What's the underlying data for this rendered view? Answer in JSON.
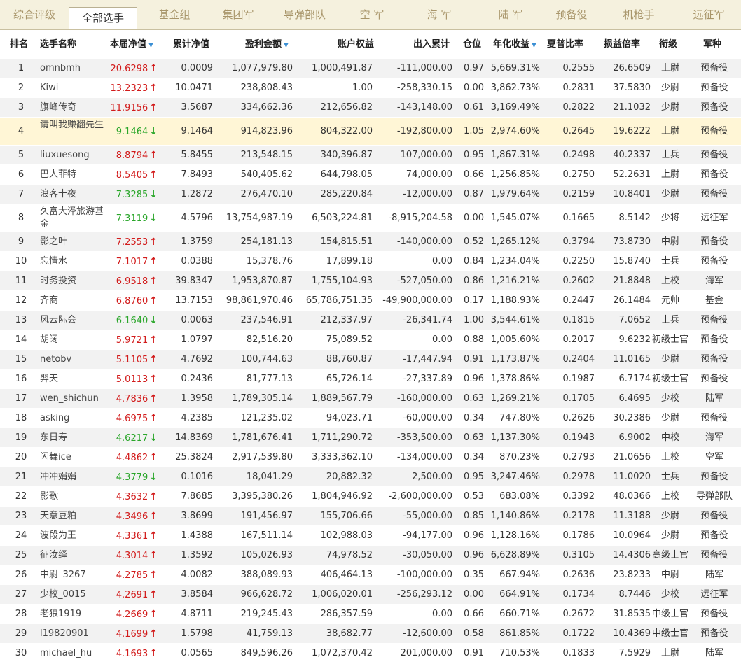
{
  "tabs": [
    {
      "label": "综合评级",
      "active": false
    },
    {
      "label": "全部选手",
      "active": true
    },
    {
      "label": "基金组",
      "active": false
    },
    {
      "label": "集团军",
      "active": false
    },
    {
      "label": "导弹部队",
      "active": false
    },
    {
      "label": "空 军",
      "active": false
    },
    {
      "label": "海 军",
      "active": false
    },
    {
      "label": "陆 军",
      "active": false
    },
    {
      "label": "预备役",
      "active": false
    },
    {
      "label": "机枪手",
      "active": false
    },
    {
      "label": "远征军",
      "active": false
    }
  ],
  "columns": [
    "排名",
    "选手名称",
    "本届净值",
    "累计净值",
    "盈利金额",
    "账户权益",
    "出入累计",
    "仓位",
    "年化收益",
    "夏普比率",
    "损益倍率",
    "衔级",
    "军种"
  ],
  "sortable_columns": [
    "本届净值",
    "盈利金额",
    "年化收益"
  ],
  "colors": {
    "up": "#d21b1b",
    "down": "#2aa62a",
    "highlight": "#fff6d6",
    "tab_bg": "#f5f1de"
  },
  "rows": [
    {
      "rank": "1",
      "name": "omnbmh",
      "nav": "20.6298",
      "dir": "up",
      "cum": "0.0009",
      "profit": "1,077,979.80",
      "equity": "1,000,491.87",
      "flow": "-111,000.00",
      "pos": "0.97",
      "annual": "5,669.31%",
      "sharpe": "0.2555",
      "pl": "26.6509",
      "grade": "上尉",
      "branch": "预备役"
    },
    {
      "rank": "2",
      "name": "Kiwi",
      "nav": "13.2323",
      "dir": "up",
      "cum": "10.0471",
      "profit": "238,808.43",
      "equity": "1.00",
      "flow": "-258,330.15",
      "pos": "0.00",
      "annual": "3,862.73%",
      "sharpe": "0.2831",
      "pl": "37.5830",
      "grade": "少尉",
      "branch": "预备役"
    },
    {
      "rank": "3",
      "name": "旗峰传奇",
      "nav": "11.9156",
      "dir": "up",
      "cum": "3.5687",
      "profit": "334,662.36",
      "equity": "212,656.82",
      "flow": "-143,148.00",
      "pos": "0.61",
      "annual": "3,169.49%",
      "sharpe": "0.2822",
      "pl": "21.1032",
      "grade": "少尉",
      "branch": "预备役"
    },
    {
      "rank": "4",
      "name": "请叫我赚翻先生",
      "nav": "9.1464",
      "dir": "down",
      "cum": "9.1464",
      "profit": "914,823.96",
      "equity": "804,322.00",
      "flow": "-192,800.00",
      "pos": "1.05",
      "annual": "2,974.60%",
      "sharpe": "0.2645",
      "pl": "19.6222",
      "grade": "上尉",
      "branch": "预备役",
      "highlight": true,
      "tall": true
    },
    {
      "rank": "5",
      "name": "liuxuesong",
      "nav": "8.8794",
      "dir": "up",
      "cum": "5.8455",
      "profit": "213,548.15",
      "equity": "340,396.87",
      "flow": "107,000.00",
      "pos": "0.95",
      "annual": "1,867.31%",
      "sharpe": "0.2498",
      "pl": "40.2337",
      "grade": "士兵",
      "branch": "预备役"
    },
    {
      "rank": "6",
      "name": "巴人菲特",
      "nav": "8.5405",
      "dir": "up",
      "cum": "7.8493",
      "profit": "540,405.62",
      "equity": "644,798.05",
      "flow": "74,000.00",
      "pos": "0.66",
      "annual": "1,256.85%",
      "sharpe": "0.2750",
      "pl": "52.2631",
      "grade": "上尉",
      "branch": "预备役"
    },
    {
      "rank": "7",
      "name": "浪客十夜",
      "nav": "7.3285",
      "dir": "down",
      "cum": "1.2872",
      "profit": "276,470.10",
      "equity": "285,220.84",
      "flow": "-12,000.00",
      "pos": "0.87",
      "annual": "1,979.64%",
      "sharpe": "0.2159",
      "pl": "10.8401",
      "grade": "少尉",
      "branch": "预备役"
    },
    {
      "rank": "8",
      "name": "久富大泽旅游基金",
      "nav": "7.3119",
      "dir": "down",
      "cum": "4.5796",
      "profit": "13,754,987.19",
      "equity": "6,503,224.81",
      "flow": "-8,915,204.58",
      "pos": "0.00",
      "annual": "1,545.07%",
      "sharpe": "0.1665",
      "pl": "8.5142",
      "grade": "少将",
      "branch": "远征军",
      "tall": true
    },
    {
      "rank": "9",
      "name": "影之叶",
      "nav": "7.2553",
      "dir": "up",
      "cum": "1.3759",
      "profit": "254,181.13",
      "equity": "154,815.51",
      "flow": "-140,000.00",
      "pos": "0.52",
      "annual": "1,265.12%",
      "sharpe": "0.3794",
      "pl": "73.8730",
      "grade": "中尉",
      "branch": "预备役"
    },
    {
      "rank": "10",
      "name": "忘情水",
      "nav": "7.1017",
      "dir": "up",
      "cum": "0.0388",
      "profit": "15,378.76",
      "equity": "17,899.18",
      "flow": "0.00",
      "pos": "0.84",
      "annual": "1,234.04%",
      "sharpe": "0.2250",
      "pl": "15.8740",
      "grade": "士兵",
      "branch": "预备役"
    },
    {
      "rank": "11",
      "name": "时务投资",
      "nav": "6.9518",
      "dir": "up",
      "cum": "39.8347",
      "profit": "1,953,870.87",
      "equity": "1,755,104.93",
      "flow": "-527,050.00",
      "pos": "0.86",
      "annual": "1,216.21%",
      "sharpe": "0.2602",
      "pl": "21.8848",
      "grade": "上校",
      "branch": "海军"
    },
    {
      "rank": "12",
      "name": "齐商",
      "nav": "6.8760",
      "dir": "up",
      "cum": "13.7153",
      "profit": "98,861,970.46",
      "equity": "65,786,751.35",
      "flow": "-49,900,000.00",
      "pos": "0.17",
      "annual": "1,188.93%",
      "sharpe": "0.2447",
      "pl": "26.1484",
      "grade": "元帅",
      "branch": "基金"
    },
    {
      "rank": "13",
      "name": "风云际会",
      "nav": "6.1640",
      "dir": "down",
      "cum": "0.0063",
      "profit": "237,546.91",
      "equity": "212,337.97",
      "flow": "-26,341.74",
      "pos": "1.00",
      "annual": "3,544.61%",
      "sharpe": "0.1815",
      "pl": "7.0652",
      "grade": "士兵",
      "branch": "预备役"
    },
    {
      "rank": "14",
      "name": "胡阔",
      "nav": "5.9721",
      "dir": "up",
      "cum": "1.0797",
      "profit": "82,516.20",
      "equity": "75,089.52",
      "flow": "0.00",
      "pos": "0.88",
      "annual": "1,005.60%",
      "sharpe": "0.2017",
      "pl": "9.6232",
      "grade": "初级士官",
      "branch": "预备役"
    },
    {
      "rank": "15",
      "name": "netobv",
      "nav": "5.1105",
      "dir": "up",
      "cum": "4.7692",
      "profit": "100,744.63",
      "equity": "88,760.87",
      "flow": "-17,447.94",
      "pos": "0.91",
      "annual": "1,173.87%",
      "sharpe": "0.2404",
      "pl": "11.0165",
      "grade": "少尉",
      "branch": "预备役"
    },
    {
      "rank": "16",
      "name": "羿天",
      "nav": "5.0113",
      "dir": "up",
      "cum": "0.2436",
      "profit": "81,777.13",
      "equity": "65,726.14",
      "flow": "-27,337.89",
      "pos": "0.96",
      "annual": "1,378.86%",
      "sharpe": "0.1987",
      "pl": "6.7174",
      "grade": "初级士官",
      "branch": "预备役"
    },
    {
      "rank": "17",
      "name": "wen_shichun",
      "nav": "4.7836",
      "dir": "up",
      "cum": "1.3958",
      "profit": "1,789,305.14",
      "equity": "1,889,567.79",
      "flow": "-160,000.00",
      "pos": "0.63",
      "annual": "1,269.21%",
      "sharpe": "0.1705",
      "pl": "6.4695",
      "grade": "少校",
      "branch": "陆军"
    },
    {
      "rank": "18",
      "name": "asking",
      "nav": "4.6975",
      "dir": "up",
      "cum": "4.2385",
      "profit": "121,235.02",
      "equity": "94,023.71",
      "flow": "-60,000.00",
      "pos": "0.34",
      "annual": "747.80%",
      "sharpe": "0.2626",
      "pl": "30.2386",
      "grade": "少尉",
      "branch": "预备役"
    },
    {
      "rank": "19",
      "name": "东日寿",
      "nav": "4.6217",
      "dir": "down",
      "cum": "14.8369",
      "profit": "1,781,676.41",
      "equity": "1,711,290.72",
      "flow": "-353,500.00",
      "pos": "0.63",
      "annual": "1,137.30%",
      "sharpe": "0.1943",
      "pl": "6.9002",
      "grade": "中校",
      "branch": "海军"
    },
    {
      "rank": "20",
      "name": "闪舞ice",
      "nav": "4.4862",
      "dir": "up",
      "cum": "25.3824",
      "profit": "2,917,539.80",
      "equity": "3,333,362.10",
      "flow": "-134,000.00",
      "pos": "0.34",
      "annual": "870.23%",
      "sharpe": "0.2793",
      "pl": "21.0656",
      "grade": "上校",
      "branch": "空军"
    },
    {
      "rank": "21",
      "name": "冲冲娟娟",
      "nav": "4.3779",
      "dir": "down",
      "cum": "0.1016",
      "profit": "18,041.29",
      "equity": "20,882.32",
      "flow": "2,500.00",
      "pos": "0.95",
      "annual": "3,247.46%",
      "sharpe": "0.2978",
      "pl": "11.0020",
      "grade": "士兵",
      "branch": "预备役"
    },
    {
      "rank": "22",
      "name": "影歌",
      "nav": "4.3632",
      "dir": "up",
      "cum": "7.8685",
      "profit": "3,395,380.26",
      "equity": "1,804,946.92",
      "flow": "-2,600,000.00",
      "pos": "0.53",
      "annual": "683.08%",
      "sharpe": "0.3392",
      "pl": "48.0366",
      "grade": "上校",
      "branch": "导弹部队"
    },
    {
      "rank": "23",
      "name": "天意豆粕",
      "nav": "4.3496",
      "dir": "up",
      "cum": "3.8699",
      "profit": "191,456.97",
      "equity": "155,706.66",
      "flow": "-55,000.00",
      "pos": "0.85",
      "annual": "1,140.86%",
      "sharpe": "0.2178",
      "pl": "11.3188",
      "grade": "少尉",
      "branch": "预备役"
    },
    {
      "rank": "24",
      "name": "波段为王",
      "nav": "4.3361",
      "dir": "up",
      "cum": "1.4388",
      "profit": "167,511.14",
      "equity": "102,988.03",
      "flow": "-94,177.00",
      "pos": "0.96",
      "annual": "1,128.16%",
      "sharpe": "0.1786",
      "pl": "10.0964",
      "grade": "少尉",
      "branch": "预备役"
    },
    {
      "rank": "25",
      "name": "征汝绎",
      "nav": "4.3014",
      "dir": "up",
      "cum": "1.3592",
      "profit": "105,026.93",
      "equity": "74,978.52",
      "flow": "-30,050.00",
      "pos": "0.96",
      "annual": "6,628.89%",
      "sharpe": "0.3105",
      "pl": "14.4306",
      "grade": "高级士官",
      "branch": "预备役"
    },
    {
      "rank": "26",
      "name": "中尉_3267",
      "nav": "4.2785",
      "dir": "up",
      "cum": "4.0082",
      "profit": "388,089.93",
      "equity": "406,464.13",
      "flow": "-100,000.00",
      "pos": "0.35",
      "annual": "667.94%",
      "sharpe": "0.2636",
      "pl": "23.8233",
      "grade": "中尉",
      "branch": "陆军"
    },
    {
      "rank": "27",
      "name": "少校_0015",
      "nav": "4.2691",
      "dir": "up",
      "cum": "3.8584",
      "profit": "966,628.72",
      "equity": "1,006,020.01",
      "flow": "-256,293.12",
      "pos": "0.00",
      "annual": "664.91%",
      "sharpe": "0.1734",
      "pl": "8.7446",
      "grade": "少校",
      "branch": "远征军"
    },
    {
      "rank": "28",
      "name": "老狼1919",
      "nav": "4.2669",
      "dir": "up",
      "cum": "4.8711",
      "profit": "219,245.43",
      "equity": "286,357.59",
      "flow": "0.00",
      "pos": "0.66",
      "annual": "660.71%",
      "sharpe": "0.2672",
      "pl": "31.8535",
      "grade": "中级士官",
      "branch": "预备役"
    },
    {
      "rank": "29",
      "name": "l19820901",
      "nav": "4.1699",
      "dir": "up",
      "cum": "1.5798",
      "profit": "41,759.13",
      "equity": "38,682.77",
      "flow": "-12,600.00",
      "pos": "0.58",
      "annual": "861.85%",
      "sharpe": "0.1722",
      "pl": "10.4369",
      "grade": "中级士官",
      "branch": "预备役"
    },
    {
      "rank": "30",
      "name": "michael_hu",
      "nav": "4.1693",
      "dir": "up",
      "cum": "0.0565",
      "profit": "849,596.26",
      "equity": "1,072,370.42",
      "flow": "201,000.00",
      "pos": "0.91",
      "annual": "710.53%",
      "sharpe": "0.1833",
      "pl": "7.5929",
      "grade": "上尉",
      "branch": "陆军"
    }
  ]
}
